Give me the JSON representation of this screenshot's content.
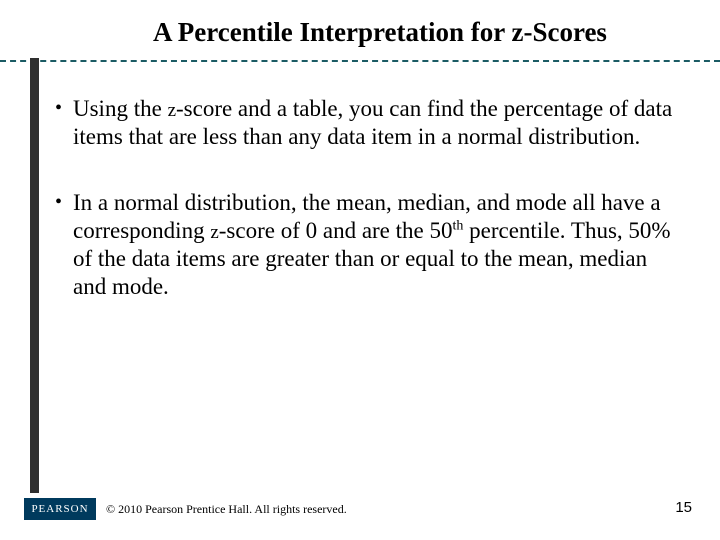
{
  "title_a": "A Percentile Interpretation for ",
  "title_z": "z",
  "title_b": "-Scores",
  "bullets": [
    {
      "a": "Using the ",
      "z": "z",
      "b": "-score and a table, you can find the percentage of data items that are less than any data item in a normal distribution."
    },
    {
      "a": "In a normal distribution, the mean, median, and mode all have a corresponding ",
      "z": "z",
      "b": "-score of 0 and are the 50",
      "sup": "th",
      "c": " percentile.  Thus, 50% of the data items are greater than or equal to the mean, median and mode."
    }
  ],
  "logo_text": "PEARSON",
  "copyright": "© 2010 Pearson Prentice Hall. All rights reserved.",
  "page_number": "15"
}
